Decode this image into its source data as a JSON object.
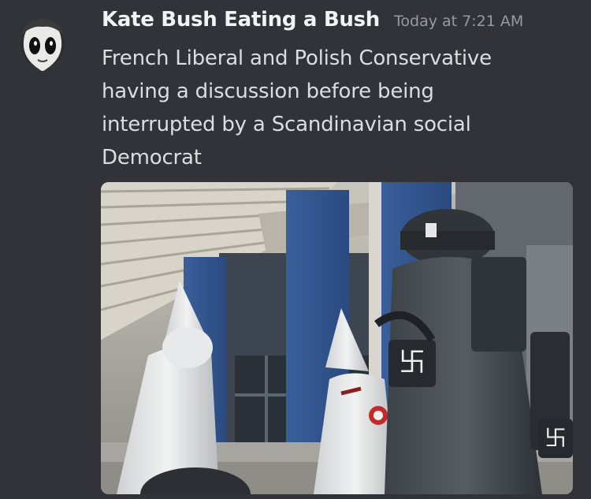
{
  "message": {
    "author": "Kate Bush Eating a Bush",
    "timestamp": "Today at 7:21 AM",
    "content": "French Liberal and Polish Conservative\nhaving a discussion before being\ninterrupted by a Scandinavian social\nDemocrat",
    "avatar_icon": "cartoon-face-avatar",
    "attachment_icon": "image-attachment"
  }
}
